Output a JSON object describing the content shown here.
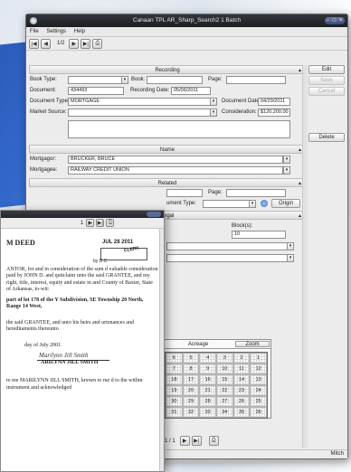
{
  "window": {
    "title": "Canaan TPL AR_Sharp_Search2 1 Batch",
    "controls": "– □ ×",
    "menu": [
      "File",
      "Settings",
      "Help"
    ],
    "page_indicator": "1/2"
  },
  "sidebar": {
    "edit": "Edit",
    "save": "Save",
    "cancel": "Cancel",
    "delete": "Delete"
  },
  "recording": {
    "header": "Recording",
    "book_type_label": "Book Type:",
    "book_type": "",
    "book_label": "Book:",
    "book": "",
    "page_label": "Page:",
    "page": "",
    "document_label": "Document:",
    "document": "434493",
    "recording_date_label": "Recording Date:",
    "recording_date": "05/06/2011",
    "document_type_label": "Document Type:",
    "document_type": "MORTGAGE",
    "document_date_label": "Document Date:",
    "document_date": "04/29/2011",
    "market_source_label": "Market Source:",
    "market_source": "",
    "consideration_label": "Consideration:",
    "consideration": "$120,200.00"
  },
  "name": {
    "header": "Name",
    "mortgagor_label": "Mortgagor:",
    "mortgagor": "BRUCKER, BRUCE",
    "mortgagee_label": "Mortgagee:",
    "mortgagee": "RAILWAY CREDIT UNION"
  },
  "related": {
    "header": "Related",
    "page_label": "Page:",
    "doc_type_label": "ument Type:",
    "origin_button": "Origin"
  },
  "legal": {
    "header": "Legal",
    "blocks_label": "Block(s):",
    "blocks": "10"
  },
  "grid": {
    "acreage_label": "Acreage",
    "zoom_label": "Zoom",
    "rows": [
      [
        "6",
        "5",
        "4",
        "3",
        "2",
        "1"
      ],
      [
        "7",
        "8",
        "9",
        "10",
        "11",
        "12"
      ],
      [
        "18",
        "17",
        "16",
        "15",
        "14",
        "13"
      ],
      [
        "19",
        "20",
        "21",
        "22",
        "23",
        "24"
      ],
      [
        "30",
        "29",
        "28",
        "27",
        "26",
        "25"
      ],
      [
        "31",
        "32",
        "33",
        "34",
        "35",
        "36"
      ]
    ]
  },
  "bottom_nav": {
    "page": "1 / 1"
  },
  "status": {
    "user": "Mitch"
  },
  "deed": {
    "page_indicator": "1",
    "heading": "M  DEED",
    "stamp_date": "JUL 28 2011",
    "stamp_clerk": "CLERK",
    "stamp_by": "by D.C.",
    "para1": "ANTOR, for and in consideration of the sum d valuable consideration paid by JOHN D. and quitclaim unto the said GRANTEE, and my right, title, interest, equity and estate in and County of Baxter, State of Arkansas, to-wit:",
    "para2": "part of lot 178 of the Y Subdivision, SE Township 20 North, Range 14 West,",
    "para3": "the said GRANTEE, and unto his heirs and urtenances and hereditaments thereunto",
    "para4": "day of July 2001.",
    "sig_script": "Marilynn Jill Smith",
    "sig_name": "ARILYNN JILL SMITH",
    "para5": "re me MARILYNN JILL SMITH, known to me d to the within instrument and acknowledged"
  }
}
